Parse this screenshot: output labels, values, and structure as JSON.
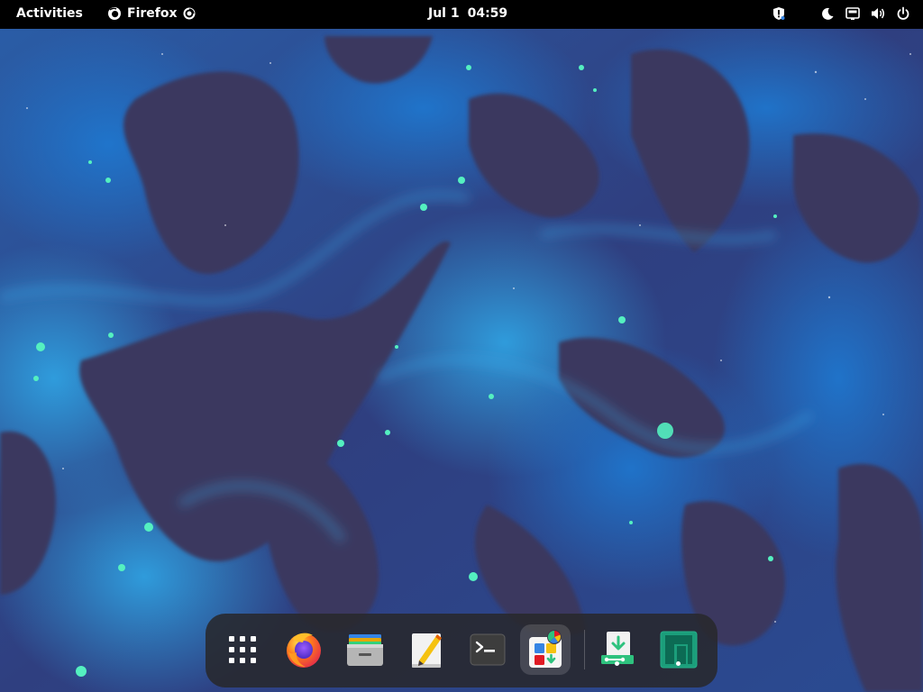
{
  "topbar": {
    "activities_label": "Activities",
    "app_name": "Firefox",
    "clock": {
      "date": "Jul 1",
      "time": "04:59"
    },
    "tray_icons": [
      "shield-alert-icon",
      "night-light-icon",
      "network-icon",
      "volume-icon",
      "power-icon"
    ]
  },
  "dock": {
    "items": [
      {
        "name": "app-grid",
        "icon": "grid-icon",
        "running": false,
        "active": false
      },
      {
        "name": "firefox",
        "icon": "firefox-icon",
        "running": false,
        "active": false
      },
      {
        "name": "files",
        "icon": "files-icon",
        "running": false,
        "active": false
      },
      {
        "name": "text-editor",
        "icon": "text-editor-icon",
        "running": false,
        "active": false
      },
      {
        "name": "terminal",
        "icon": "terminal-icon",
        "running": false,
        "active": false
      },
      {
        "name": "software",
        "icon": "software-store-icon",
        "running": false,
        "active": true
      },
      {
        "name": "installer",
        "icon": "installer-download-icon",
        "running": true,
        "active": false
      },
      {
        "name": "manjaro-hello",
        "icon": "manjaro-logo-icon",
        "running": true,
        "active": false
      }
    ]
  },
  "colors": {
    "topbar_bg": "#000000",
    "dock_bg": "#28282c",
    "wallpaper_dark": "#37365e",
    "wallpaper_blue": "#1f6fc0",
    "wallpaper_glow": "#40e0b0"
  }
}
